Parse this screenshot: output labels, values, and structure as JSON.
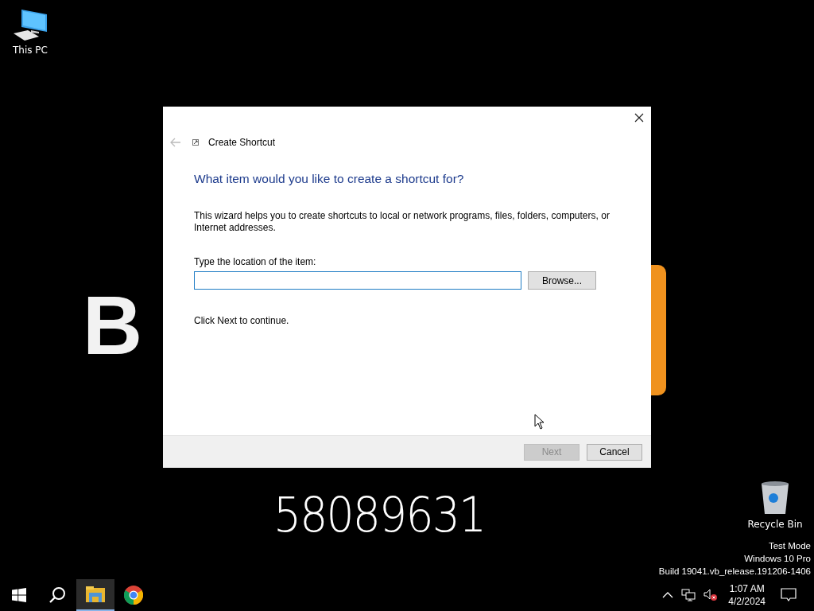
{
  "desktop_icons": [
    {
      "kind": "computer",
      "label": "This PC"
    },
    {
      "kind": "recycle",
      "label": "Recycle Bin"
    }
  ],
  "wallpaper": {
    "title": "B",
    "code": "58089631"
  },
  "dialog": {
    "title": "Create Shortcut",
    "heading": "What item would you like to create a shortcut for?",
    "description": "This wizard helps you to create shortcuts to local or network programs, files, folders, computers, or Internet addresses.",
    "field_label": "Type the location of the item:",
    "field": {
      "focused": true
    },
    "browse": "Browse...",
    "hint": "Click Next to continue.",
    "buttons": [
      {
        "label": "Next",
        "disabled": true
      },
      {
        "label": "Cancel",
        "disabled": false
      }
    ]
  },
  "watermark": [
    "Test Mode",
    "Windows 10 Pro",
    "Build 19041.vb_release.191206-1406"
  ],
  "taskbar": {
    "apps": [
      {
        "kind": "start",
        "active": false
      },
      {
        "kind": "search",
        "active": false
      },
      {
        "kind": "explorer",
        "active": true
      },
      {
        "kind": "chrome",
        "active": false
      }
    ],
    "time": "1:07 AM",
    "date": "4/2/2024"
  }
}
